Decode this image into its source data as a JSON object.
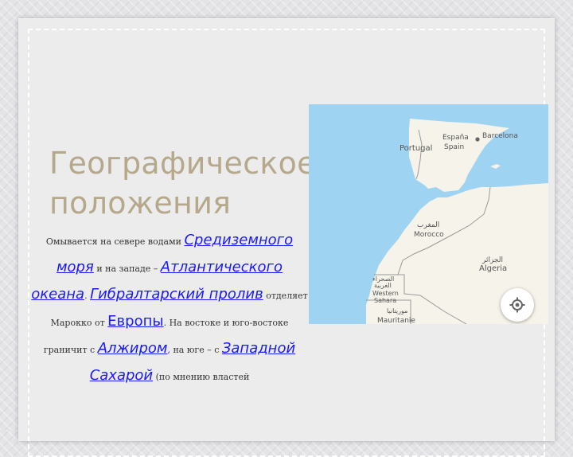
{
  "title": "Географическое положения",
  "body": {
    "t1": "Омывается на севере водами ",
    "l1": "Средиземного моря",
    "t2": " и на западе – ",
    "l2": "Атлантического океана",
    "t3": ". ",
    "l3": "Гибралтарский пролив",
    "t4": " отделяет Марокко от ",
    "l4": "Европы",
    "t5": ". На востоке и юго-востоке граничит с ",
    "l5": "Алжиром",
    "t6": ", на юге – с ",
    "l6": "Западной Сахарой",
    "t7": " (по мнению властей"
  },
  "map": {
    "labels": {
      "portugal": "Portugal",
      "espana": "España",
      "spain": "Spain",
      "barcelona": "Barcelona",
      "morocco_ar": "المغرب",
      "morocco": "Morocco",
      "algeria_ar": "الجزائر",
      "algeria": "Algeria",
      "ws_ar1": "الصحراء",
      "ws_ar2": "الغربية",
      "ws1": "Western",
      "ws2": "Sahara",
      "mauritania_ar": "موريتانيا",
      "mauritania": "Mauritanie"
    },
    "colors": {
      "sea": "#9fd3f2",
      "land": "#f5f3ea",
      "border": "#9a9a9a"
    },
    "locate_icon": "my-location-icon"
  }
}
